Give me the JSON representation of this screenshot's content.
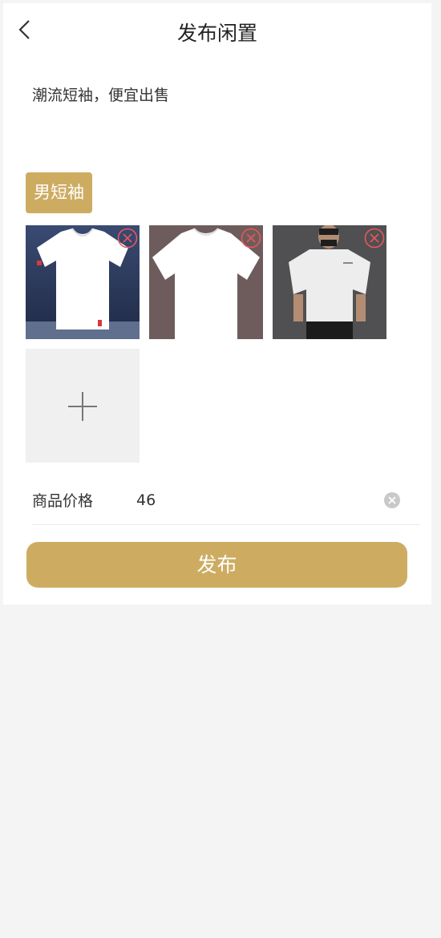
{
  "header": {
    "title": "发布闲置"
  },
  "description": "潮流短袖，便宜出售",
  "tag": {
    "label": "男短袖"
  },
  "images": [
    {
      "subject": "white v-neck t-shirt on blue background"
    },
    {
      "subject": "white crew-neck t-shirt on brown background"
    },
    {
      "subject": "man wearing white t-shirt"
    }
  ],
  "price": {
    "label": "商品价格",
    "value": "46"
  },
  "publish_button": {
    "label": "发布"
  },
  "colors": {
    "accent": "#cdac62",
    "remove": "#e8585a",
    "page_bg": "#f4f4f4"
  }
}
